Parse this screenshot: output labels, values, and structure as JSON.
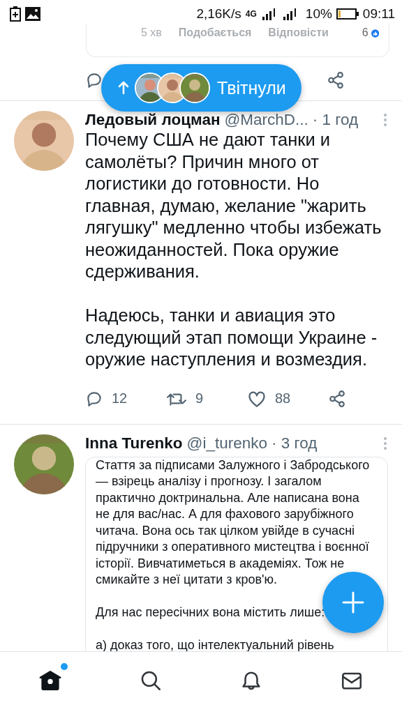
{
  "status_bar": {
    "speed": "2,16K/s",
    "network": "4G",
    "battery": "10%",
    "time": "09:11"
  },
  "previous_tweet": {
    "quote_meta": [
      {
        "text": "5 хв",
        "kind": "time"
      },
      {
        "text": "Подобається",
        "kind": "action"
      },
      {
        "text": "Відповісти",
        "kind": "action"
      }
    ],
    "quote_likes": "6"
  },
  "new_tweets_pill": {
    "label": "Твітнули"
  },
  "tweets": [
    {
      "name": "Ледовый лоцман",
      "handle": "@MarchD...",
      "time": "· 1 год",
      "paragraphs": [
        "Почему США не дают танки и самолёты? Причин много от логистики до готовности. Но главная, думаю, желание \"жарить лягушку\" медленно чтобы избежать неожиданностей. Пока оружие сдерживания.",
        "Надеюсь, танки и авиация это следующий этап помощи Украине - оружие наступления и возмездия."
      ],
      "replies": "12",
      "retweets": "9",
      "likes": "88"
    },
    {
      "name": "Inna Turenko",
      "handle": "@i_turenko",
      "time": "· 3 год",
      "quote_paragraphs": [
        "Стаття за підписами Залужного і Забродського — взірець аналізу і прогнозу. І загалом практично доктринальна. Але написана вона не для вас/нас. А для фахового зарубіжного читача. Вона ось так цілком увійде в сучасні підручники з оперативного мистецтва і воєнної історії. Вивчатиметься в академіях. Тож не смикайте з неї цитати з кров'ю.",
        "Для нас пересічних вона містить лише:",
        "а) доказ того, що інтелектуальний рівень"
      ]
    }
  ],
  "bottom_nav": [
    {
      "kind": "home",
      "selected": true,
      "badge": true
    },
    {
      "kind": "search",
      "selected": false,
      "badge": false
    },
    {
      "kind": "notifications",
      "selected": false,
      "badge": false
    },
    {
      "kind": "messages",
      "selected": false,
      "badge": false
    }
  ]
}
